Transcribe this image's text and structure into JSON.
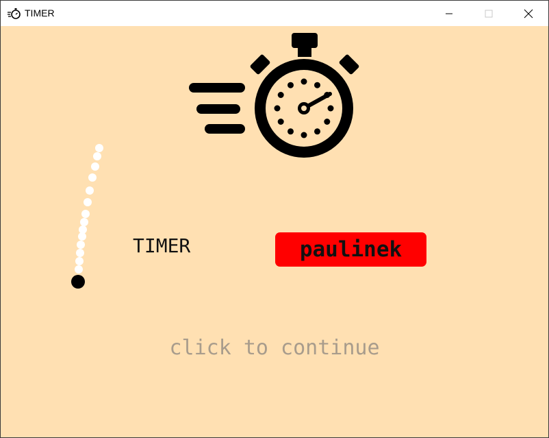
{
  "window": {
    "title": "TIMER",
    "controls": {
      "minimize": "minimize-icon",
      "maximize": "maximize-icon",
      "close": "close-icon"
    }
  },
  "colors": {
    "background": "#ffe0b2",
    "name_box": "#ff0000",
    "continue_text": "#a89c8c",
    "trail": "#ffffff"
  },
  "main": {
    "logo_icon": "stopwatch-icon",
    "label": "TIMER",
    "name": "paulinek",
    "continue_prompt": "click to continue"
  }
}
